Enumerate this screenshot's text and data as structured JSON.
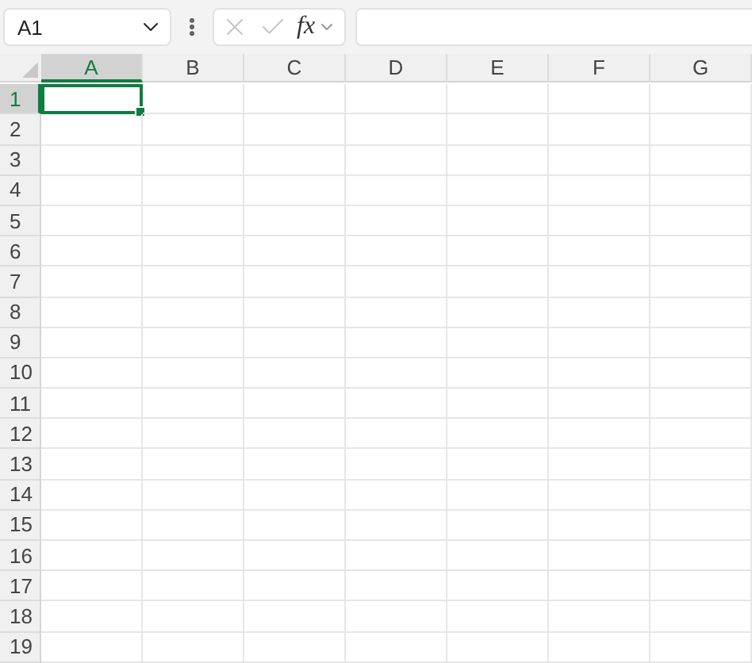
{
  "name_box": {
    "value": "A1"
  },
  "formula_bar": {
    "cancel_disabled": true,
    "enter_disabled": true,
    "function_label": "fx"
  },
  "columns": [
    {
      "label": "A",
      "selected": true
    },
    {
      "label": "B",
      "selected": false
    },
    {
      "label": "C",
      "selected": false
    },
    {
      "label": "D",
      "selected": false
    },
    {
      "label": "E",
      "selected": false
    },
    {
      "label": "F",
      "selected": false
    },
    {
      "label": "G",
      "selected": false
    }
  ],
  "rows": [
    {
      "label": "1",
      "selected": true
    },
    {
      "label": "2",
      "selected": false
    },
    {
      "label": "3",
      "selected": false
    },
    {
      "label": "4",
      "selected": false
    },
    {
      "label": "5",
      "selected": false
    },
    {
      "label": "6",
      "selected": false
    },
    {
      "label": "7",
      "selected": false
    },
    {
      "label": "8",
      "selected": false
    },
    {
      "label": "9",
      "selected": false
    },
    {
      "label": "10",
      "selected": false
    },
    {
      "label": "11",
      "selected": false
    },
    {
      "label": "12",
      "selected": false
    },
    {
      "label": "13",
      "selected": false
    },
    {
      "label": "14",
      "selected": false
    },
    {
      "label": "15",
      "selected": false
    },
    {
      "label": "16",
      "selected": false
    },
    {
      "label": "17",
      "selected": false
    },
    {
      "label": "18",
      "selected": false
    },
    {
      "label": "19",
      "selected": false
    }
  ]
}
